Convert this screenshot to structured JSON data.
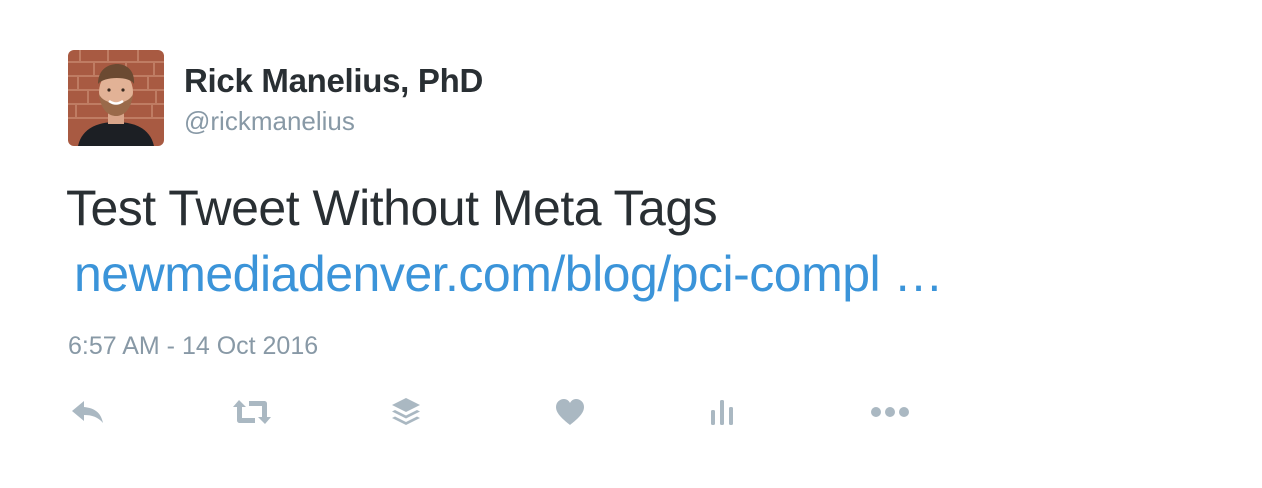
{
  "author": {
    "name": "Rick Manelius, PhD",
    "handle": "@rickmanelius"
  },
  "tweet": {
    "text": "Test Tweet Without Meta Tags",
    "link": "newmediadenver.com/blog/pci-compl …",
    "timestamp": "6:57 AM - 14 Oct 2016"
  },
  "actions": [
    {
      "name": "reply",
      "icon": "reply-icon"
    },
    {
      "name": "retweet",
      "icon": "retweet-icon"
    },
    {
      "name": "buffer",
      "icon": "layers-icon"
    },
    {
      "name": "like",
      "icon": "heart-icon"
    },
    {
      "name": "analytics",
      "icon": "bar-chart-icon"
    },
    {
      "name": "more",
      "icon": "more-dots-icon"
    }
  ],
  "colors": {
    "text": "#292f33",
    "muted": "#8899a6",
    "link": "#3b94d9",
    "icon": "#aab8c2"
  }
}
